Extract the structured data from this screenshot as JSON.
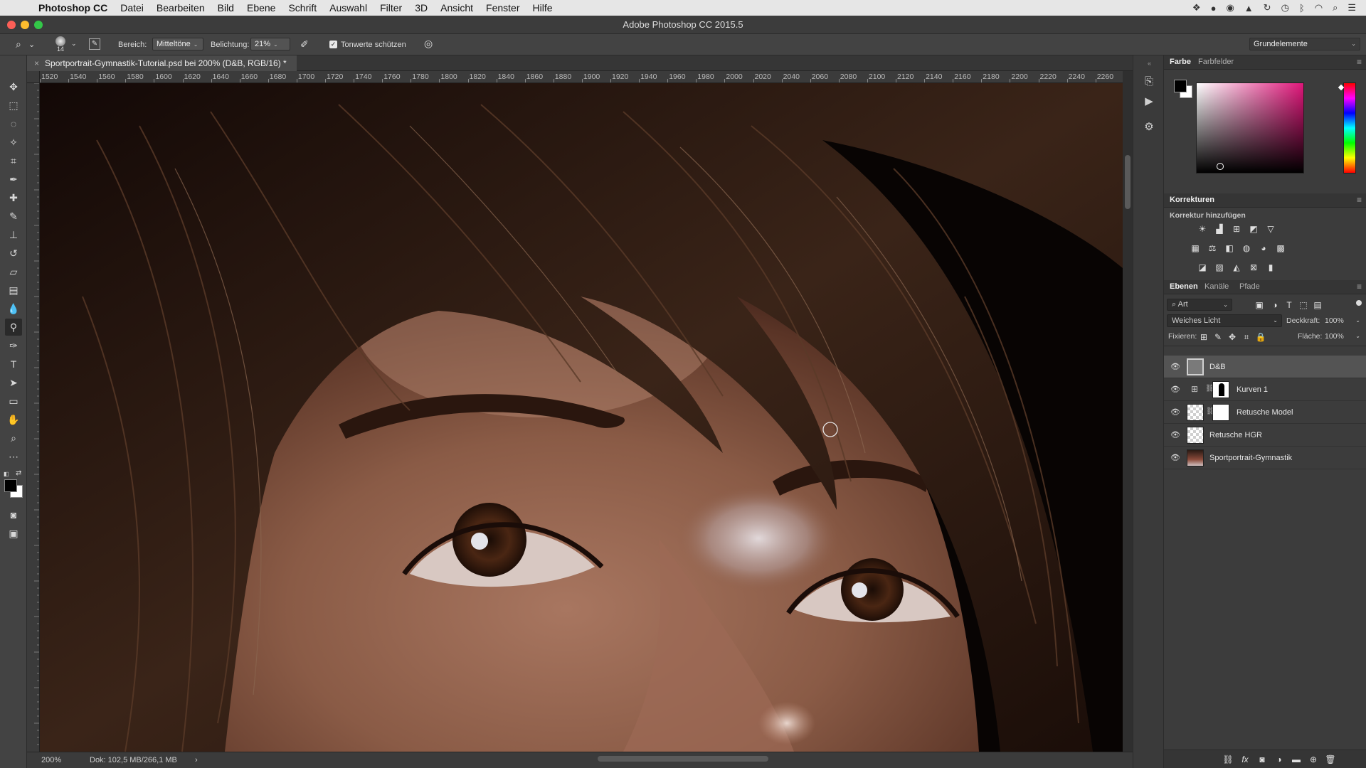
{
  "menubar": {
    "app_name": "Photoshop CC",
    "items": [
      "Datei",
      "Bearbeiten",
      "Bild",
      "Ebene",
      "Schrift",
      "Auswahl",
      "Filter",
      "3D",
      "Ansicht",
      "Fenster",
      "Hilfe"
    ]
  },
  "window": {
    "title": "Adobe Photoshop CC 2015.5"
  },
  "options": {
    "brush_size": "14",
    "range_label": "Bereich:",
    "range_value": "Mitteltöne",
    "exposure_label": "Belichtung:",
    "exposure_value": "21%",
    "protect_tones_label": "Tonwerte schützen",
    "protect_tones_checked": true,
    "workspace": "Grundelemente"
  },
  "document": {
    "tab_title": "Sportportrait-Gymnastik-Tutorial.psd bei 200% (D&B, RGB/16) *",
    "ruler_ticks": [
      "1520",
      "1540",
      "1560",
      "1580",
      "1600",
      "1620",
      "1640",
      "1660",
      "1680",
      "1700",
      "1720",
      "1740",
      "1760",
      "1780",
      "1800",
      "1820",
      "1840",
      "1860",
      "1880",
      "1900",
      "1920",
      "1940",
      "1960",
      "1980",
      "2000",
      "2020",
      "2040",
      "2060",
      "2080",
      "2100",
      "2120",
      "2140",
      "2160",
      "2180",
      "2200",
      "2220",
      "2240",
      "2260"
    ]
  },
  "status": {
    "zoom": "200%",
    "doc_info": "Dok: 102,5 MB/266,1 MB"
  },
  "color_panel": {
    "tabs": [
      "Farbe",
      "Farbfelder"
    ],
    "foreground": "#000000",
    "background": "#ffffff",
    "hue_color": "#e0167a"
  },
  "adjustments_panel": {
    "title": "Korrekturen",
    "subtitle": "Korrektur hinzufügen"
  },
  "layers_panel": {
    "tabs": [
      "Ebenen",
      "Kanäle",
      "Pfade"
    ],
    "filter_kind": "Art",
    "blend_mode": "Weiches Licht",
    "opacity_label": "Deckkraft:",
    "opacity_value": "100%",
    "lock_label": "Fixieren:",
    "fill_label": "Fläche:",
    "fill_value": "100%",
    "layers": [
      {
        "name": "D&B",
        "selected": true
      },
      {
        "name": "Kurven 1",
        "selected": false
      },
      {
        "name": "Retusche Model",
        "selected": false
      },
      {
        "name": "Retusche HGR",
        "selected": false
      },
      {
        "name": "Sportportrait-Gymnastik",
        "selected": false
      }
    ]
  }
}
